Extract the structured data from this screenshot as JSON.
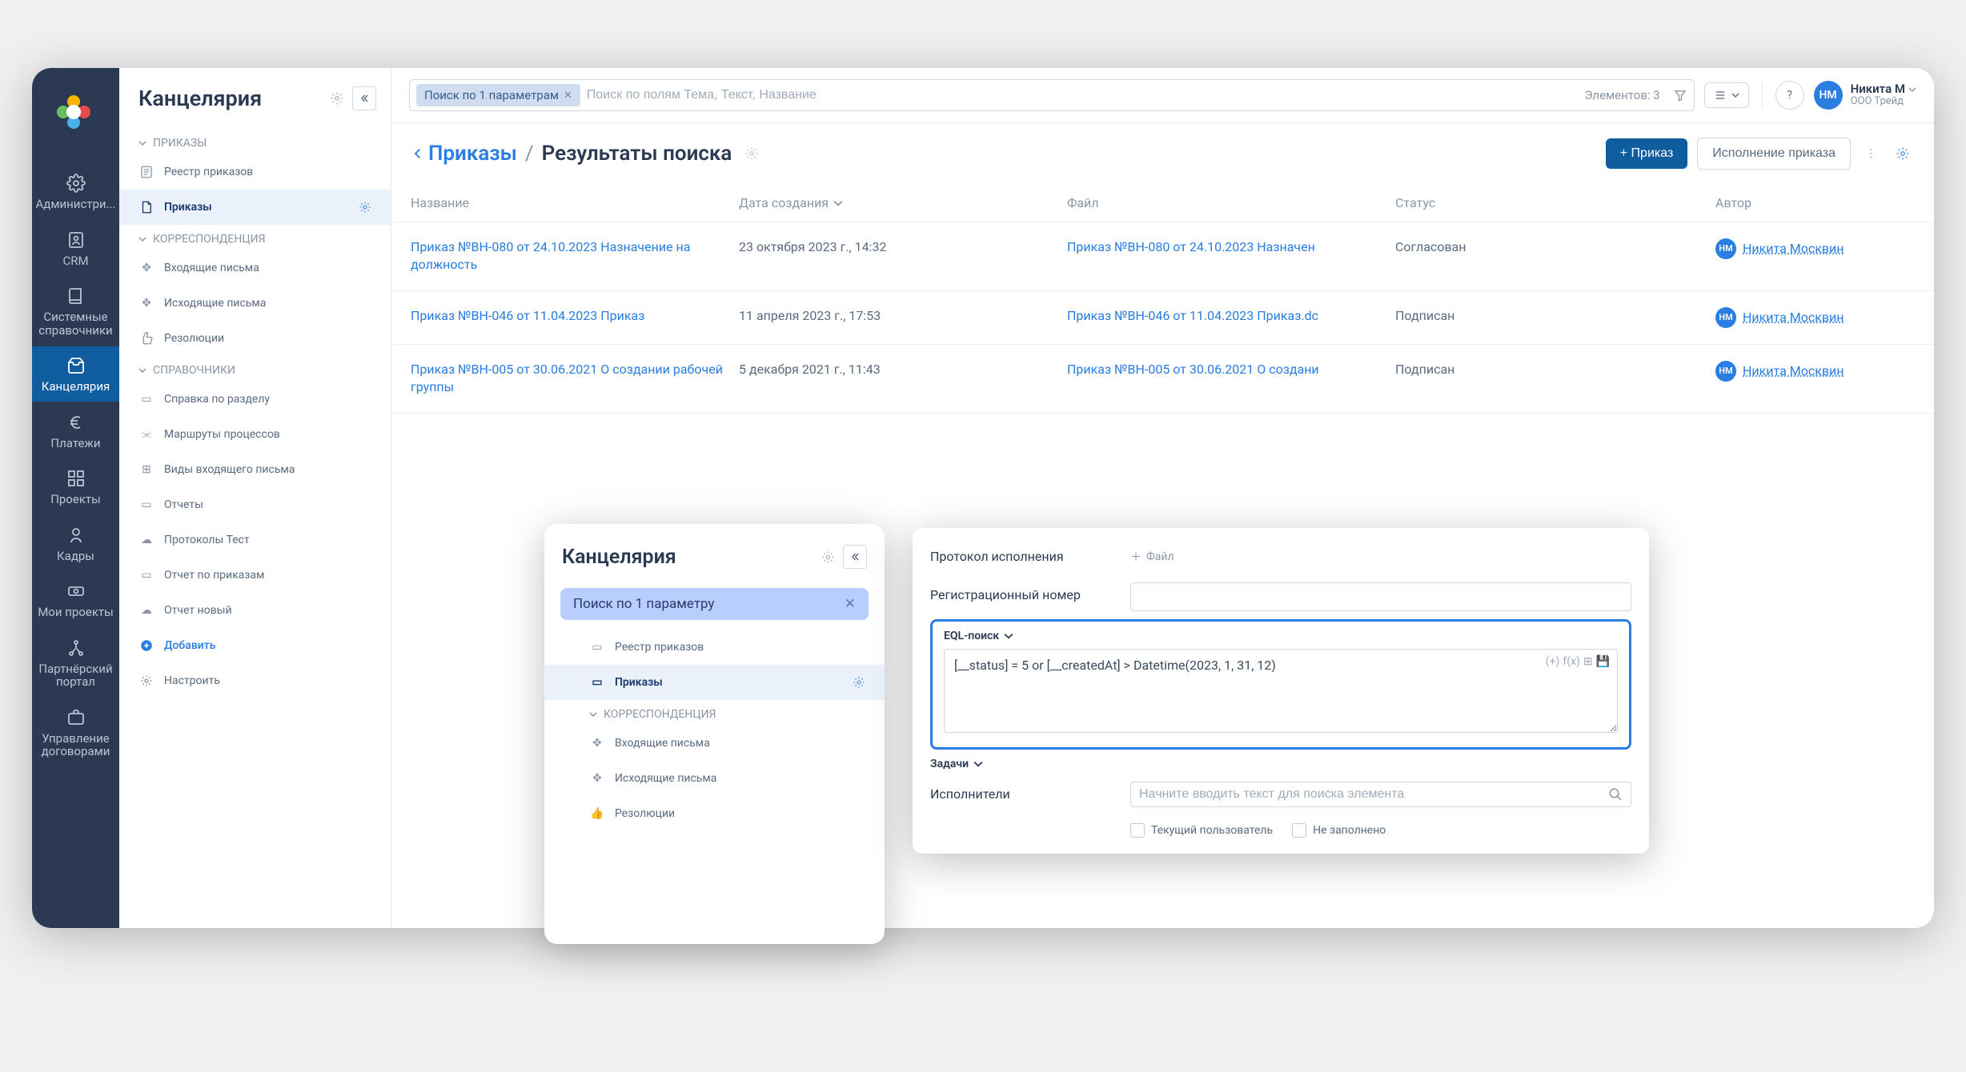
{
  "rail": [
    {
      "label": "Администри...",
      "icon": "gear"
    },
    {
      "label": "CRM",
      "icon": "contacts"
    },
    {
      "label": "Системные справочники",
      "icon": "book"
    },
    {
      "label": "Канцелярия",
      "icon": "inbox",
      "active": true
    },
    {
      "label": "Платежи",
      "icon": "euro"
    },
    {
      "label": "Проекты",
      "icon": "grid"
    },
    {
      "label": "Кадры",
      "icon": "person"
    },
    {
      "label": "Мои проекты",
      "icon": "money"
    },
    {
      "label": "Партнёрский портал",
      "icon": "share"
    },
    {
      "label": "Управление договорами",
      "icon": "briefcase"
    }
  ],
  "sidebar": {
    "title": "Канцелярия",
    "groups": [
      {
        "label": "ПРИКАЗЫ",
        "items": [
          {
            "label": "Реестр приказов",
            "icon": "doc"
          },
          {
            "label": "Приказы",
            "icon": "page",
            "active": true,
            "gear": true
          }
        ]
      },
      {
        "label": "КОРРЕСПОНДЕНЦИЯ",
        "items": [
          {
            "label": "Входящие письма",
            "icon": "inbox2"
          },
          {
            "label": "Исходящие письма",
            "icon": "outbox"
          },
          {
            "label": "Резолюции",
            "icon": "thumb"
          }
        ]
      },
      {
        "label": "СПРАВОЧНИКИ",
        "items": [
          {
            "label": "Справка по разделу",
            "icon": "page"
          },
          {
            "label": "Маршруты процессов",
            "icon": "route"
          },
          {
            "label": "Виды входящего письма",
            "icon": "types"
          },
          {
            "label": "Отчеты",
            "icon": "page"
          },
          {
            "label": "Протоколы Тест",
            "icon": "cloud"
          },
          {
            "label": "Отчет по приказам",
            "icon": "page"
          },
          {
            "label": "Отчет новый",
            "icon": "cloud"
          }
        ]
      }
    ],
    "add": "Добавить",
    "configure": "Настроить"
  },
  "topbar": {
    "chip": "Поиск по 1 параметрам",
    "placeholder": "Поиск по полям Тема, Текст, Название",
    "count": "Элементов: 3"
  },
  "user": {
    "initials": "НМ",
    "name": "Никита М",
    "org": "ООО Трейд"
  },
  "crumb": {
    "back": "Приказы",
    "current": "Результаты поиска",
    "primary": "+ Приказ",
    "secondary": "Исполнение приказа"
  },
  "table": {
    "headers": {
      "name": "Название",
      "date": "Дата создания",
      "file": "Файл",
      "status": "Статус",
      "author": "Автор"
    },
    "rows": [
      {
        "name": "Приказ №ВН-080 от 24.10.2023 Назначение на должность",
        "date": "23 октября 2023 г., 14:32",
        "file": "Приказ №ВН-080 от 24.10.2023 Назначен",
        "status": "Согласован",
        "author": "Никита Москвин",
        "ai": "НМ"
      },
      {
        "name": "Приказ №ВН-046 от 11.04.2023 Приказ",
        "date": "11 апреля 2023 г., 17:53",
        "file": "Приказ №ВН-046 от 11.04.2023 Приказ.dc",
        "status": "Подписан",
        "author": "Никита Москвин",
        "ai": "НМ"
      },
      {
        "name": "Приказ №ВН-005 от 30.06.2021 О создании рабочей группы",
        "date": "5 декабря 2021 г., 11:43",
        "file": "Приказ №ВН-005 от 30.06.2021 О создани",
        "status": "Подписан",
        "author": "Никита Москвин",
        "ai": "НМ"
      }
    ]
  },
  "popup_sidebar": {
    "title": "Канцелярия",
    "chip": "Поиск по 1 параметру",
    "items": [
      {
        "label": "Реестр приказов",
        "icon": "doc"
      },
      {
        "label": "Приказы",
        "icon": "page",
        "active": true,
        "gear": true
      }
    ],
    "group2": "КОРРЕСПОНДЕНЦИЯ",
    "items2": [
      {
        "label": "Входящие письма",
        "icon": "inbox2"
      },
      {
        "label": "Исходящие письма",
        "icon": "outbox"
      },
      {
        "label": "Резолюции",
        "icon": "thumb"
      }
    ]
  },
  "popup_form": {
    "labels": {
      "protocol": "Протокол исполнения",
      "regnum": "Регистрационный номер",
      "file": "Файл",
      "eql": "EQL-поиск",
      "tasks": "Задачи",
      "executors": "Исполнители"
    },
    "eql_value": "[__status] = 5 or [__createdAt] > Datetime(2023, 1, 31, 12)",
    "exec_placeholder": "Начните вводить текст для поиска элемента",
    "chk1": "Текущий пользователь",
    "chk2": "Не заполнено"
  }
}
